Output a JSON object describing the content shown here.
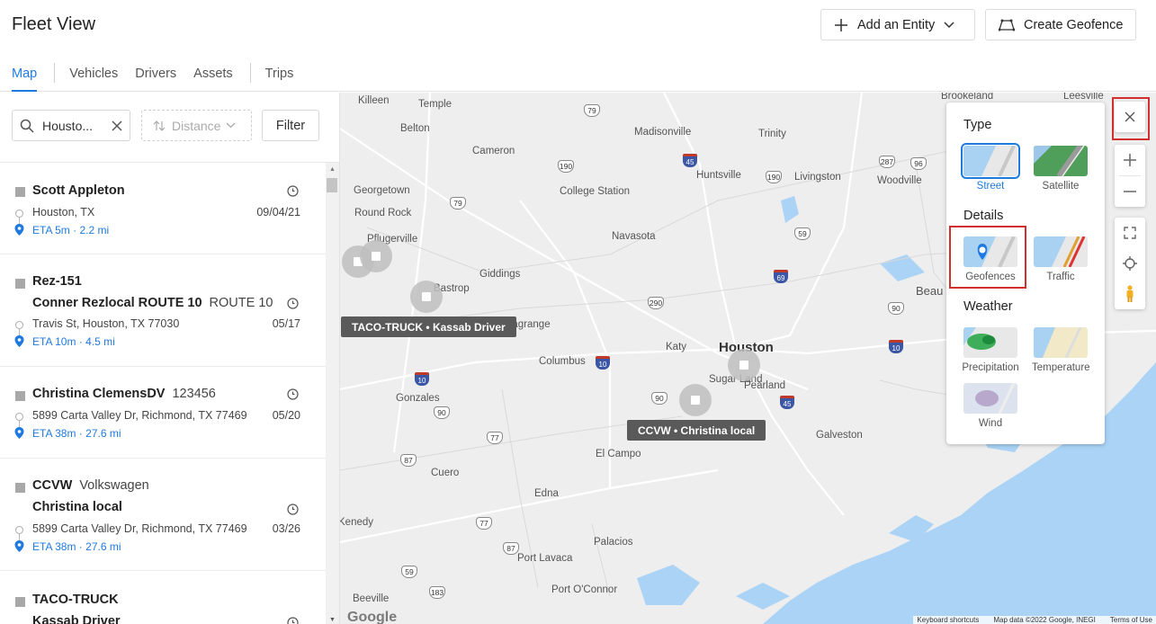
{
  "header": {
    "title": "Fleet View",
    "add_entity": "Add an Entity",
    "create_geofence": "Create Geofence"
  },
  "tabs": [
    {
      "label": "Map",
      "active": true
    },
    {
      "label": "Vehicles"
    },
    {
      "label": "Drivers"
    },
    {
      "label": "Assets"
    },
    {
      "label": "Trips"
    }
  ],
  "filters": {
    "search_value": "Housto...",
    "distance_label": "Distance",
    "filter_label": "Filter"
  },
  "entities": [
    {
      "name": "Scott Appleton",
      "address": "Houston, TX",
      "date": "09/04/21",
      "eta": "ETA 5m",
      "dist": "2.2 mi"
    },
    {
      "name": "Rez-151",
      "driver": "Conner Rezlocal ROUTE 10",
      "driver_sub": "ROUTE 10",
      "address": "Travis St, Houston, TX 77030",
      "date": "05/17",
      "eta": "ETA 10m",
      "dist": "4.5 mi"
    },
    {
      "name": "Christina ClemensDV",
      "name_sub": "123456",
      "address": "5899 Carta Valley Dr, Richmond, TX 77469",
      "date": "05/20",
      "eta": "ETA 38m",
      "dist": "27.6 mi"
    },
    {
      "name": "CCVW",
      "name_sub": "Volkswagen",
      "driver": "Christina local",
      "address": "5899 Carta Valley Dr, Richmond, TX 77469",
      "date": "03/26",
      "eta": "ETA 38m",
      "dist": "27.6 mi"
    },
    {
      "name": "TACO-TRUCK",
      "driver": "Kassab Driver"
    }
  ],
  "map": {
    "cities": [
      "Brookeland",
      "Leesville",
      "Killeen",
      "Temple",
      "Belton",
      "Madisonville",
      "Trinity",
      "Cameron",
      "Georgetown",
      "Huntsville",
      "Livingston",
      "Woodville",
      "College Station",
      "Round Rock",
      "Pflugerville",
      "Navasota",
      "Giddings",
      "Beau",
      "Katy",
      "Houston",
      "Columbus",
      "Sugar Land",
      "Pearland",
      "Gonzales",
      "Galveston",
      "El Campo",
      "Cuero",
      "Edna",
      "Palacios",
      "Port Lavaca",
      "Port O'Connor",
      "Beeville",
      "Kenedy",
      "Bastrop",
      "Lagrange"
    ],
    "marker_labels": [
      "TACO-TRUCK • Kassab Driver",
      "CCVW • Christina local"
    ],
    "attribution": [
      "Keyboard shortcuts",
      "Map data ©2022 Google, INEGI",
      "Terms of Use"
    ],
    "google": "Google"
  },
  "layers": {
    "type_title": "Type",
    "street": "Street",
    "satellite": "Satellite",
    "details_title": "Details",
    "geofences": "Geofences",
    "traffic": "Traffic",
    "weather_title": "Weather",
    "precipitation": "Precipitation",
    "temperature": "Temperature",
    "wind": "Wind"
  },
  "colors": {
    "accent": "#1f7ae0",
    "highlight": "#d32f2f",
    "water": "#aad3f5"
  }
}
